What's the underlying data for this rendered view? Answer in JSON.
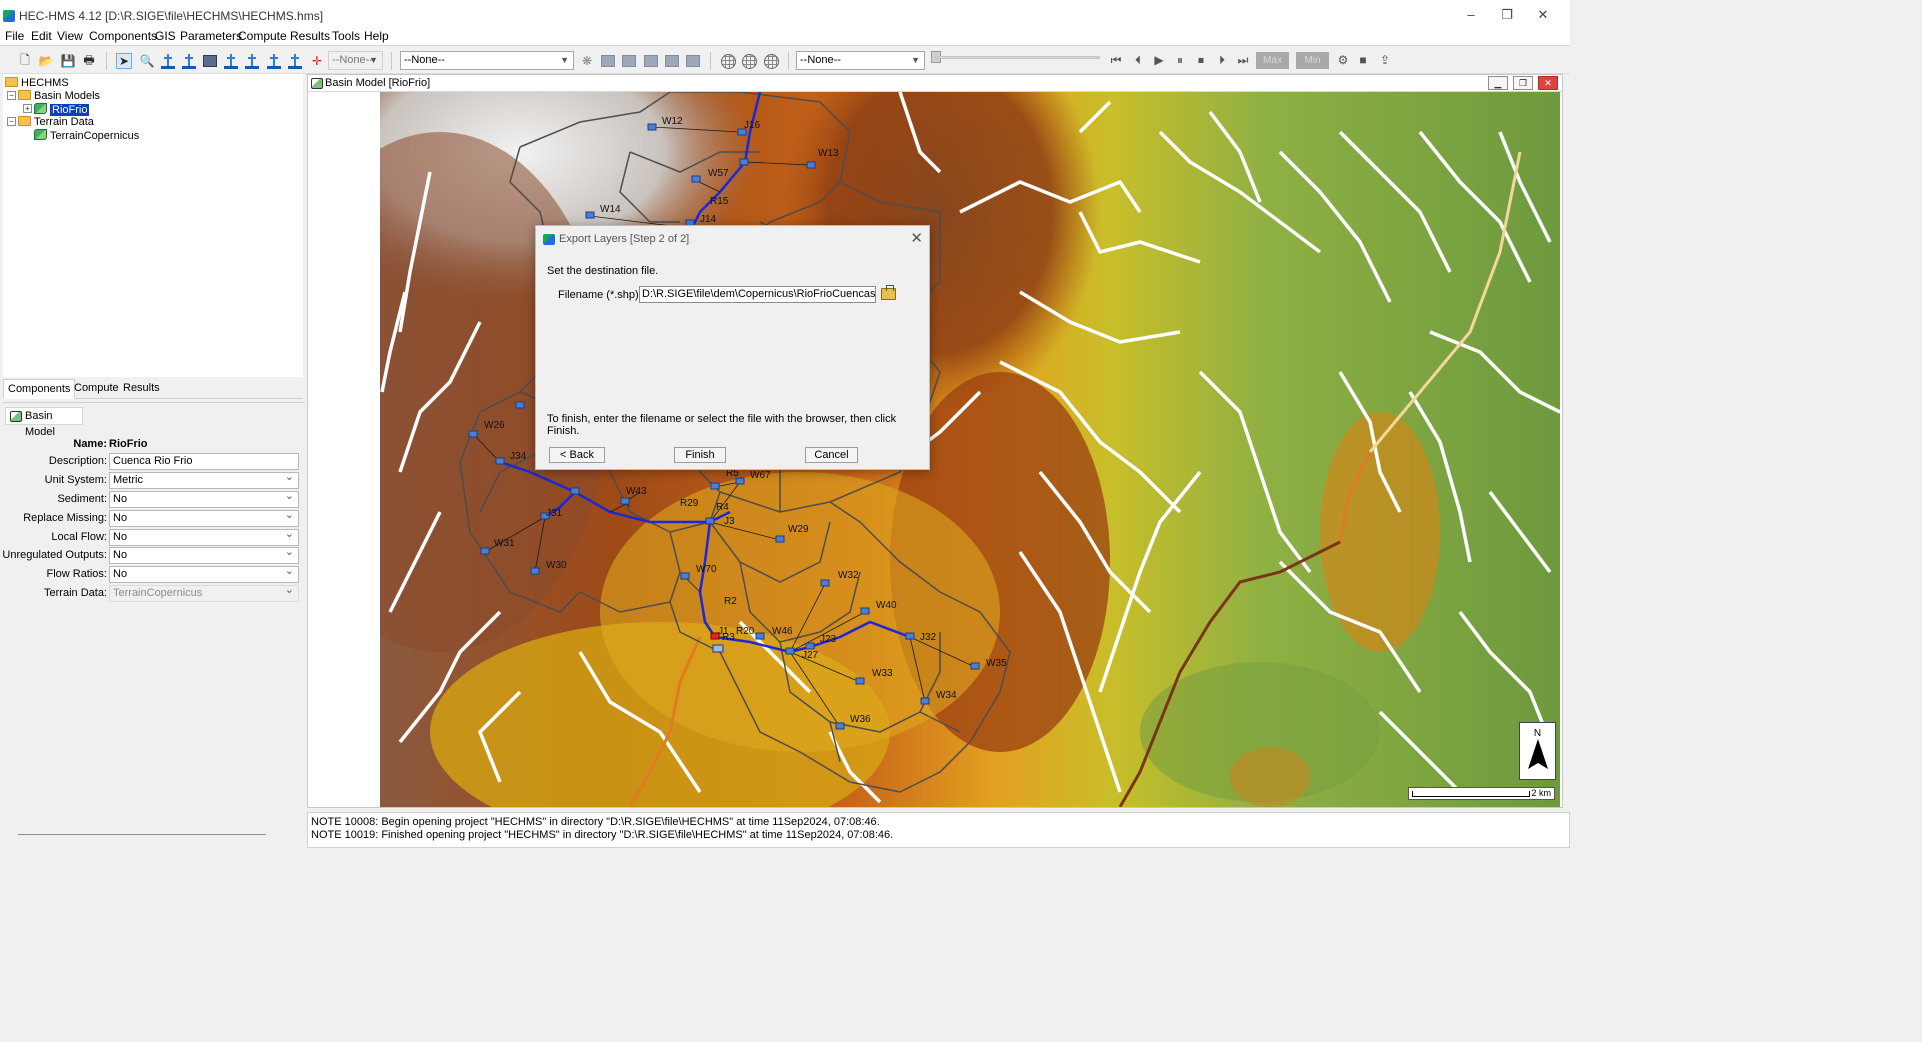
{
  "window": {
    "title": "HEC-HMS 4.12 [D:\\R.SIGE\\file\\HECHMS\\HECHMS.hms]",
    "controls": [
      "–",
      "❐",
      "✕"
    ]
  },
  "menu": [
    "File",
    "Edit",
    "View",
    "Components",
    "GIS",
    "Parameters",
    "Compute",
    "Results",
    "Tools",
    "Help"
  ],
  "toolbar": {
    "combo1": "--None--",
    "combo2": "--None--",
    "combo3": "--None--",
    "max_label": "Max",
    "min_label": "Min"
  },
  "tree": {
    "root": "HECHMS",
    "basin_models": "Basin Models",
    "riofrio": "RioFrio",
    "terrain_data": "Terrain Data",
    "terrain_copernicus": "TerrainCopernicus"
  },
  "tabs": [
    "Components",
    "Compute",
    "Results"
  ],
  "properties": {
    "header": "Basin Model",
    "name_label": "Name:",
    "name_value": "RioFrio",
    "fields": [
      {
        "label": "Description:",
        "value": "Cuenca Rio Frio",
        "type": "text"
      },
      {
        "label": "Unit System:",
        "value": "Metric",
        "type": "dropdown"
      },
      {
        "label": "Sediment:",
        "value": "No",
        "type": "dropdown"
      },
      {
        "label": "Replace Missing:",
        "value": "No",
        "type": "dropdown"
      },
      {
        "label": "Local Flow:",
        "value": "No",
        "type": "dropdown"
      },
      {
        "label": "Unregulated Outputs:",
        "value": "No",
        "type": "dropdown"
      },
      {
        "label": "Flow Ratios:",
        "value": "No",
        "type": "dropdown"
      },
      {
        "label": "Terrain Data:",
        "value": "TerrainCopernicus",
        "type": "disabled"
      }
    ]
  },
  "basin_window": {
    "title": "Basin Model [RioFrio]",
    "north_label": "N",
    "scale_label": "2 km",
    "map_labels": [
      "W12",
      "J16",
      "W13",
      "W57",
      "R15",
      "W14",
      "J14",
      "W26",
      "J34",
      "W43",
      "R5",
      "W67",
      "R29",
      "R4",
      "J3",
      "W29",
      "W31",
      "J31",
      "W30",
      "W70",
      "W32",
      "R2",
      "W40",
      "J1",
      "W46",
      "J23",
      "J32",
      "W35",
      "J27",
      "W33",
      "W34",
      "W36",
      "R3",
      "R20"
    ]
  },
  "dialog": {
    "title": "Export Layers [Step 2 of 2]",
    "instruction": "Set the destination file.",
    "filename_label": "Filename (*.shp):",
    "filename_value": "D:\\R.SIGE\\file\\dem\\Copernicus\\RioFrioCuencas.shp",
    "finish_hint": "To finish, enter the filename or select the file with the browser, then click Finish.",
    "back_label": "< Back",
    "finish_label": "Finish",
    "cancel_label": "Cancel"
  },
  "console": {
    "lines": [
      "NOTE 10008:  Begin opening project \"HECHMS\" in directory \"D:\\R.SIGE\\file\\HECHMS\" at time 11Sep2024, 07:08:46.",
      "NOTE 10019:  Finished opening project \"HECHMS\" in directory \"D:\\R.SIGE\\file\\HECHMS\" at time 11Sep2024, 07:08:46."
    ]
  }
}
